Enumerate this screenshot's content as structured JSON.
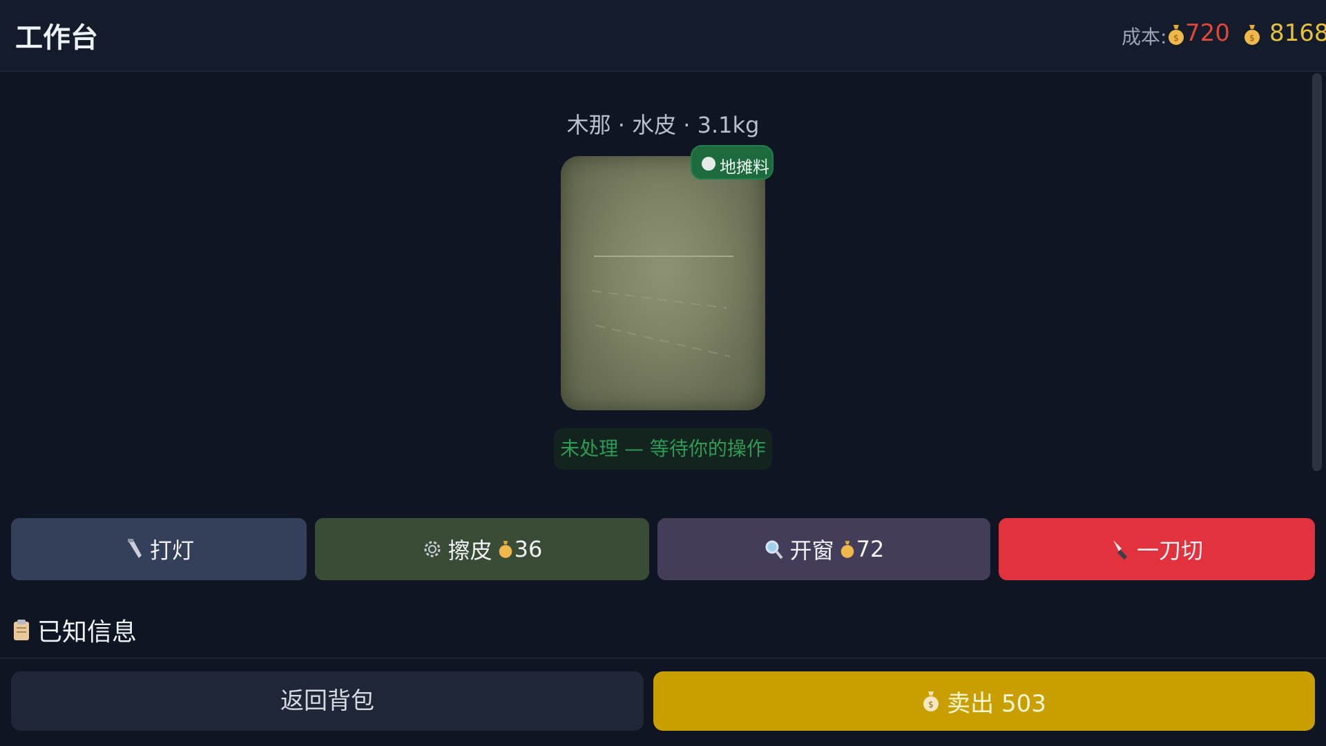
{
  "header": {
    "title": "工作台",
    "cost_label": "成本:",
    "cost_value": "720",
    "money_value": "8168"
  },
  "stone": {
    "title": "木那 · 水皮 · 3.1kg",
    "tag_label": "地摊料",
    "status": "未处理 — 等待你的操作"
  },
  "actions": [
    {
      "label": "打灯",
      "icon": "flashlight-icon",
      "cost": ""
    },
    {
      "label": "擦皮",
      "icon": "gear-icon",
      "cost": "36"
    },
    {
      "label": "开窗",
      "icon": "magnifier-icon",
      "cost": "72"
    },
    {
      "label": "一刀切",
      "icon": "knife-icon",
      "cost": ""
    }
  ],
  "known_info": {
    "label": "已知信息",
    "icon": "clipboard-icon"
  },
  "footer": {
    "back_label": "返回背包",
    "sell_label": "卖出 503"
  },
  "colors": {
    "background": "#0f1523",
    "cost_red": "#e0463c",
    "money_gold": "#e5c23a",
    "tag_green": "#1c6a3e",
    "status_green": "#2e9a55",
    "light_button": "#34405a",
    "peel_button": "#3a4c35",
    "window_button": "#443d5a",
    "cut_button": "#e2323e",
    "sell_button": "#c99f00"
  }
}
